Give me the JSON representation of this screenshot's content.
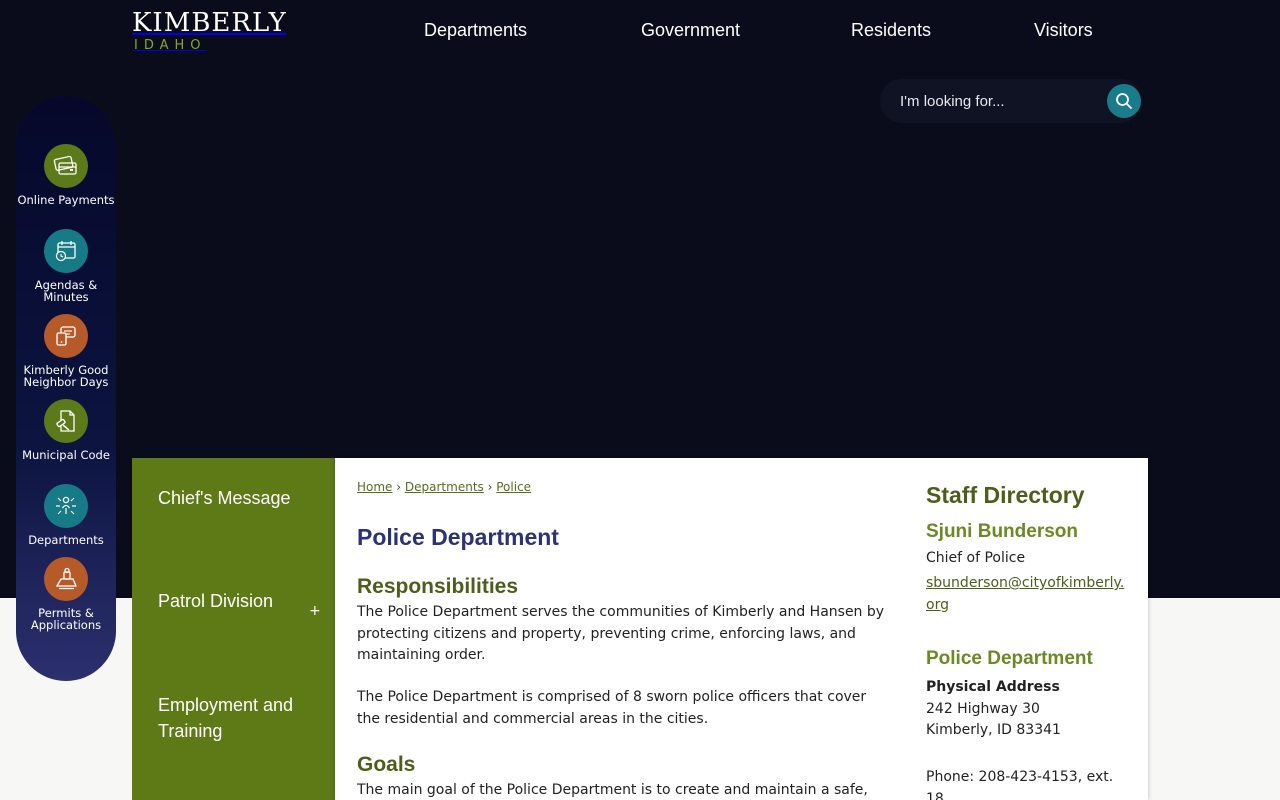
{
  "colors": {
    "header_bg": "#0a0c1c",
    "accent_green": "#5e7a17",
    "title_blue": "#2b3373",
    "heading_green": "#4c5f1a",
    "teal": "#177a87",
    "orange": "#b65a2a"
  },
  "logo": {
    "name": "KIMBERLY",
    "sub": "IDAHO"
  },
  "nav": {
    "departments": "Departments",
    "government": "Government",
    "residents": "Residents",
    "visitors": "Visitors"
  },
  "search": {
    "placeholder": "I'm looking for...",
    "icon": "search-icon"
  },
  "quick_links": [
    {
      "label": "Online Payments",
      "icon": "credit-card-icon",
      "color": "green"
    },
    {
      "label": "Agendas & Minutes",
      "icon": "calendar-clock-icon",
      "color": "teal"
    },
    {
      "label": "Kimberly Good Neighbor Days",
      "icon": "chat-bubbles-icon",
      "color": "orange"
    },
    {
      "label": "Municipal Code",
      "icon": "gavel-document-icon",
      "color": "green"
    },
    {
      "label": "Departments",
      "icon": "org-people-icon",
      "color": "teal"
    },
    {
      "label": "Permits & Applications",
      "icon": "permit-stamp-icon",
      "color": "orange"
    }
  ],
  "sidenav": {
    "items": [
      {
        "label": "Chief's Message"
      },
      {
        "label": "Patrol Division",
        "expand": "+"
      },
      {
        "label": "Employment and Training"
      }
    ]
  },
  "breadcrumb": {
    "home": "Home",
    "sep": "›",
    "departments": "Departments",
    "police": "Police"
  },
  "main": {
    "title": "Police Department",
    "responsibilities_heading": "Responsibilities",
    "para1": "The Police Department serves the communities of Kimberly and Hansen by protecting citizens and property, preventing crime, enforcing laws, and maintaining order.",
    "para2": "The Police Department is comprised of 8 sworn police officers that cover the residential and commercial areas in the cities.",
    "goals_heading": "Goals",
    "goals_para": "The main goal of the Police Department is to create and maintain a safe,"
  },
  "staff": {
    "heading": "Staff Directory",
    "name": "Sjuni Bunderson",
    "role": "Chief of Police",
    "email": "sbunderson@cityofkimberly.org",
    "dept_heading": "Police Department",
    "address_label": "Physical Address",
    "address_line1": "242 Highway 30",
    "address_line2": "Kimberly, ID 83341",
    "phone": "Phone: 208-423-4153, ext. 18"
  }
}
